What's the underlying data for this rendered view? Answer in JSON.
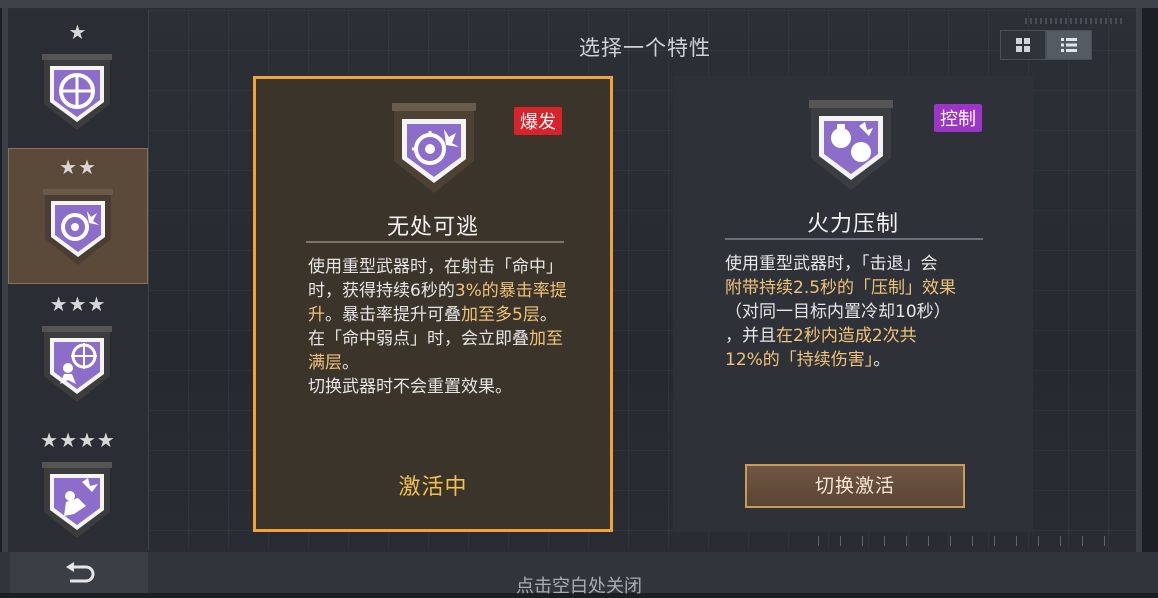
{
  "header": {
    "title": "选择一个特性"
  },
  "view_toggle": {
    "grid_icon": "grid-icon",
    "list_icon": "list-icon",
    "active": "list"
  },
  "sidebar": {
    "tiers": [
      {
        "stars": "★",
        "selected": false,
        "icon": "crosshair-shield-icon"
      },
      {
        "stars": "★★",
        "selected": true,
        "icon": "target-explosion-shield-icon"
      },
      {
        "stars": "★★★",
        "selected": false,
        "icon": "target-figure-shield-icon"
      },
      {
        "stars": "★★★★",
        "selected": false,
        "icon": "blast-figure-shield-icon"
      }
    ]
  },
  "cards": [
    {
      "tag": "爆发",
      "tag_color": "#d8232a",
      "name": "无处可逃",
      "desc": [
        {
          "t": "使用重型武器时，在射击「命中」时，获得持续6秒的"
        },
        {
          "t": "3%的暴击率提升",
          "hl": true
        },
        {
          "t": "。暴击率提升可叠"
        },
        {
          "t": "加至多5层",
          "hl": true
        },
        {
          "t": "。"
        },
        {
          "t": "在「命中弱点」时，会立即叠"
        },
        {
          "t": "加至满层",
          "hl": true
        },
        {
          "t": "。"
        },
        {
          "t": "切换武器时不会重置效果。"
        }
      ],
      "status": "激活中"
    },
    {
      "tag": "控制",
      "tag_color": "#9b35c6",
      "name": "火力压制",
      "desc": [
        {
          "t": "使用重型武器时，「击退」会"
        },
        {
          "t": "附带持续2.5秒的「压制」效果",
          "hl": true
        },
        {
          "t": "（对同一目标内置冷却10秒）"
        },
        {
          "t": "，并且"
        },
        {
          "t": "在2秒内造成2次共",
          "hl": true
        },
        {
          "t": "12%的「持续伤害」",
          "hl": true
        },
        {
          "t": "。"
        }
      ],
      "button": "切换激活"
    }
  ],
  "footer": {
    "close_hint": "点击空白处关闭",
    "back_icon": "return-arrow-icon"
  },
  "colors": {
    "accent": "#f0a33a",
    "highlight_text": "#f0c278",
    "status": "#f2c14e"
  }
}
